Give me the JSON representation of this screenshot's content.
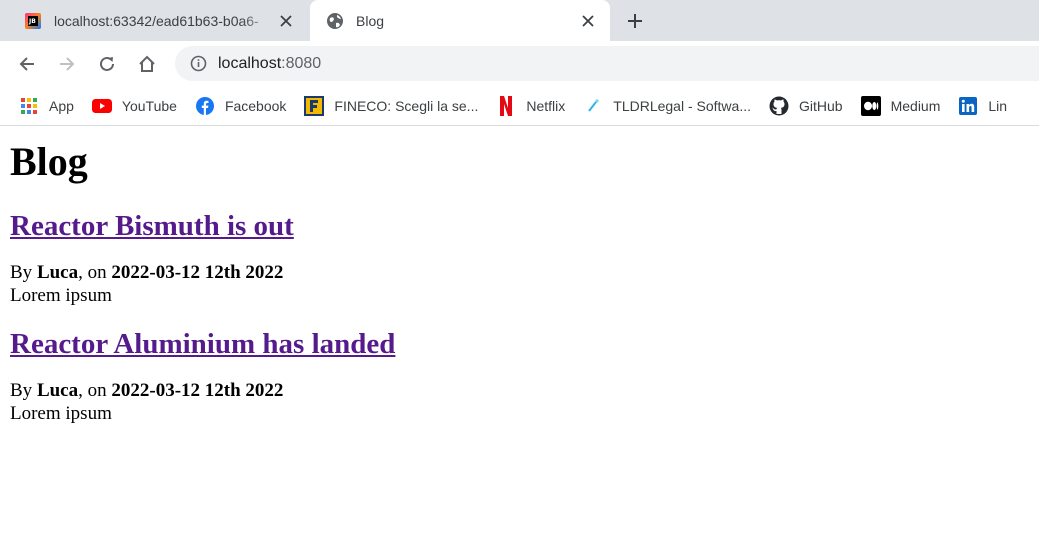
{
  "browser": {
    "tabs": [
      {
        "title": "localhost:63342/ead61b63-b0a6-",
        "active": false,
        "icon": "jetbrains-icon"
      },
      {
        "title": "Blog",
        "active": true,
        "icon": "globe-icon"
      }
    ],
    "address": {
      "host": "localhost",
      "port": ":8080"
    },
    "bookmarks": [
      {
        "label": "App",
        "icon": "apps-grid-icon"
      },
      {
        "label": "YouTube",
        "icon": "youtube-icon"
      },
      {
        "label": "Facebook",
        "icon": "facebook-icon"
      },
      {
        "label": "FINECO: Scegli la se...",
        "icon": "fineco-icon"
      },
      {
        "label": "Netflix",
        "icon": "netflix-icon"
      },
      {
        "label": "TLDRLegal - Softwa...",
        "icon": "tldrlegal-icon"
      },
      {
        "label": "GitHub",
        "icon": "github-icon"
      },
      {
        "label": "Medium",
        "icon": "medium-icon"
      },
      {
        "label": "Lin",
        "icon": "linkedin-icon"
      }
    ]
  },
  "page": {
    "heading": "Blog",
    "posts": [
      {
        "title": "Reactor Bismuth is out",
        "by": "By ",
        "author": "Luca",
        "on": ", on ",
        "date": "2022-03-12 12th 2022",
        "body": "Lorem ipsum"
      },
      {
        "title": "Reactor Aluminium has landed",
        "by": "By ",
        "author": "Luca",
        "on": ", on ",
        "date": "2022-03-12 12th 2022",
        "body": "Lorem ipsum"
      }
    ]
  },
  "colors": {
    "link_visited": "#551a8b",
    "tabstrip": "#dee1e6",
    "omnibox": "#f1f3f4"
  }
}
